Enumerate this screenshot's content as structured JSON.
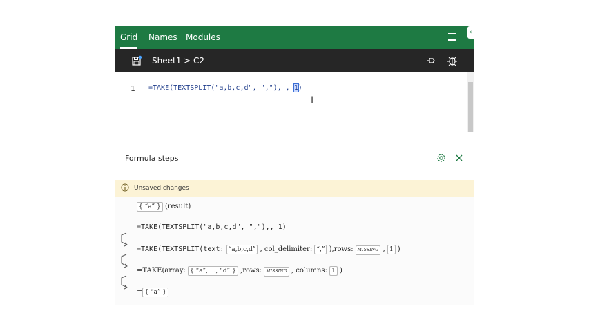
{
  "tabs": [
    {
      "label": "Grid",
      "active": true
    },
    {
      "label": "Names",
      "active": false
    },
    {
      "label": "Modules",
      "active": false
    }
  ],
  "toolbar": {
    "breadcrumb": "Sheet1 > C2"
  },
  "editor": {
    "line_number": "1",
    "code_before": "=TAKE(TEXTSPLIT(\"a,b,c,d\", \",\"), , ",
    "code_selected": "1",
    "code_after": ")"
  },
  "formula_steps": {
    "title": "Formula steps",
    "banner": "Unsaved changes",
    "result_value": "{ “a” }",
    "result_label": "(result)",
    "step1": "=TAKE(TEXTSPLIT(\"a,b,c,d\", \",\"),, 1)",
    "step2": {
      "prefix": "=TAKE(TEXTSPLIT(text:",
      "text_value": "“a,b,c,d”",
      "delim_label": ",  col_delimiter:",
      "delim_value": "“,”",
      "rows_label": "),rows:",
      "rows_value": "MISSING",
      "comma": ",",
      "cols_value": "1",
      "suffix": ")"
    },
    "step3": {
      "prefix": "=TAKE(array:",
      "array_value": "{ “a”, ..., “d” }",
      "rows_label": ",rows:",
      "rows_value": "MISSING",
      "columns_label": ",  columns:",
      "columns_value": "1",
      "suffix": ")"
    },
    "step4": {
      "prefix": "=",
      "value": "{ “a” }"
    }
  },
  "colors": {
    "tabbar": "#1e7a43",
    "toolbar": "#262626",
    "banner": "#fcf3d6",
    "accent": "#1e7a43"
  },
  "icons": [
    "hamburger-menu-icon",
    "save-icon",
    "pin-icon",
    "debug-icon",
    "settings-icon",
    "close-icon",
    "info-icon",
    "step-arrow-icon"
  ]
}
